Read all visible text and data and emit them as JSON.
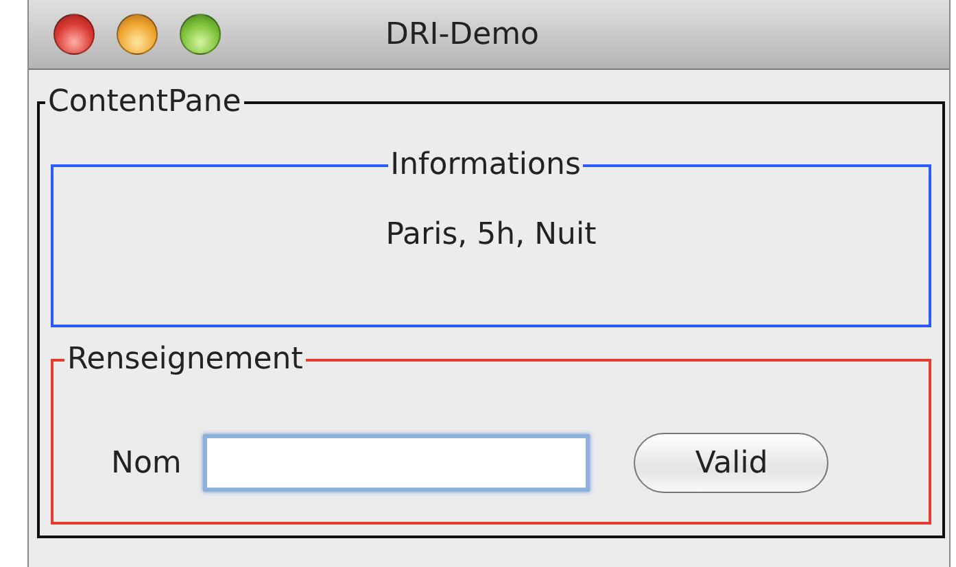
{
  "window": {
    "title": "DRI-Demo"
  },
  "content_pane": {
    "title": "ContentPane",
    "panels": [
      {
        "kind": "info",
        "title": "Informations",
        "color": "#2a5bff",
        "text": "Paris, 5h, Nuit"
      },
      {
        "kind": "form",
        "title": "Renseignement",
        "color": "#e63b2e",
        "label": "Nom",
        "button": "Valid"
      }
    ]
  }
}
